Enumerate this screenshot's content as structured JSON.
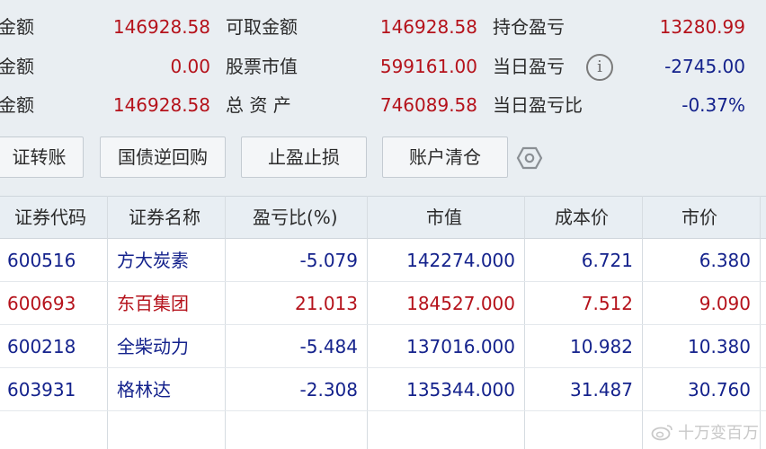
{
  "summary": {
    "row1": {
      "l1": "金额",
      "v1": "146928.58",
      "l2": "可取金额",
      "v2": "146928.58",
      "l3": "持仓盈亏",
      "v3": "13280.99"
    },
    "row2": {
      "l1": "金额",
      "v1": "0.00",
      "l2": "股票市值",
      "v2": "599161.00",
      "l3": "当日盈亏",
      "v3": "-2745.00"
    },
    "row3": {
      "l1": "金额",
      "v1": "146928.58",
      "l2": "总 资 产",
      "v2": "746089.58",
      "l3": "当日盈亏比",
      "v3": "-0.37%"
    },
    "info_icon_glyph": "i"
  },
  "buttons": {
    "transfer": "证转账",
    "repo": "国债逆回购",
    "stop": "止盈止损",
    "clear": "账户清仓"
  },
  "table": {
    "headers": [
      "证券代码",
      "证券名称",
      "盈亏比(%)",
      "市值",
      "成本价",
      "市价"
    ],
    "rows": [
      {
        "code": "600516",
        "name": "方大炭素",
        "pct": "-5.079",
        "mv": "142274.000",
        "cost": "6.721",
        "price": "6.380"
      },
      {
        "code": "600693",
        "name": "东百集团",
        "pct": "21.013",
        "mv": "184527.000",
        "cost": "7.512",
        "price": "9.090"
      },
      {
        "code": "600218",
        "name": "全柴动力",
        "pct": "-5.484",
        "mv": "137016.000",
        "cost": "10.982",
        "price": "10.380"
      },
      {
        "code": "603931",
        "name": "格林达",
        "pct": "-2.308",
        "mv": "135344.000",
        "cost": "31.487",
        "price": "30.760"
      }
    ]
  },
  "watermark": {
    "text": "十万变百万",
    "icon": "weibo-icon"
  },
  "colors": {
    "gain": "#b5121b",
    "loss": "#14228c",
    "panel_bg": "#e9eef2"
  }
}
